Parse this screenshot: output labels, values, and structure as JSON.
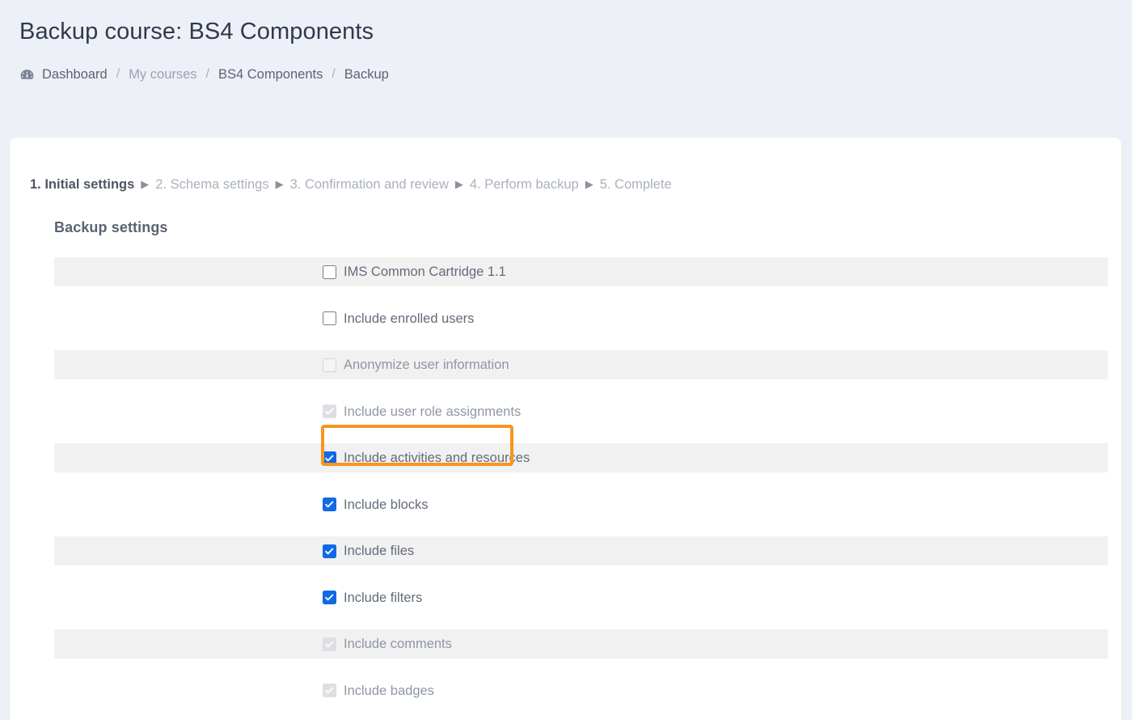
{
  "header": {
    "title": "Backup course: BS4 Components"
  },
  "breadcrumb": {
    "icon": "tachometer-dashboard-icon",
    "separator": "/",
    "items": [
      {
        "label": "Dashboard",
        "muted": false
      },
      {
        "label": "My courses",
        "muted": true
      },
      {
        "label": "BS4 Components",
        "muted": false
      },
      {
        "label": "Backup",
        "muted": false
      }
    ]
  },
  "stepnav": {
    "arrow": "▶",
    "steps": [
      {
        "label": "1. Initial settings",
        "current": true
      },
      {
        "label": "2. Schema settings",
        "current": false
      },
      {
        "label": "3. Confirmation and review",
        "current": false
      },
      {
        "label": "4. Perform backup",
        "current": false
      },
      {
        "label": "5. Complete",
        "current": false
      }
    ]
  },
  "settings": {
    "section_title": "Backup settings",
    "rows": [
      {
        "label": "IMS Common Cartridge 1.1",
        "checked": false,
        "disabled": false,
        "striped": true
      },
      {
        "label": "Include enrolled users",
        "checked": false,
        "disabled": false,
        "striped": false
      },
      {
        "label": "Anonymize user information",
        "checked": false,
        "disabled": true,
        "striped": true
      },
      {
        "label": "Include user role assignments",
        "checked": true,
        "disabled": true,
        "striped": false
      },
      {
        "label": "Include activities and resources",
        "checked": true,
        "disabled": false,
        "striped": true
      },
      {
        "label": "Include blocks",
        "checked": true,
        "disabled": false,
        "striped": false
      },
      {
        "label": "Include files",
        "checked": true,
        "disabled": false,
        "striped": true
      },
      {
        "label": "Include filters",
        "checked": true,
        "disabled": false,
        "striped": false
      },
      {
        "label": "Include comments",
        "checked": true,
        "disabled": true,
        "striped": true
      },
      {
        "label": "Include badges",
        "checked": true,
        "disabled": true,
        "striped": false
      }
    ]
  },
  "annotation": {
    "target_label": "Include enrolled users",
    "color": "#f79520"
  },
  "colors": {
    "page_background": "#eef0f7",
    "card_background": "#ffffff",
    "stripe": "#f1f1f2",
    "checkbox_accent": "#1169e5",
    "text": "#636c7a",
    "highlight": "#f79520"
  }
}
